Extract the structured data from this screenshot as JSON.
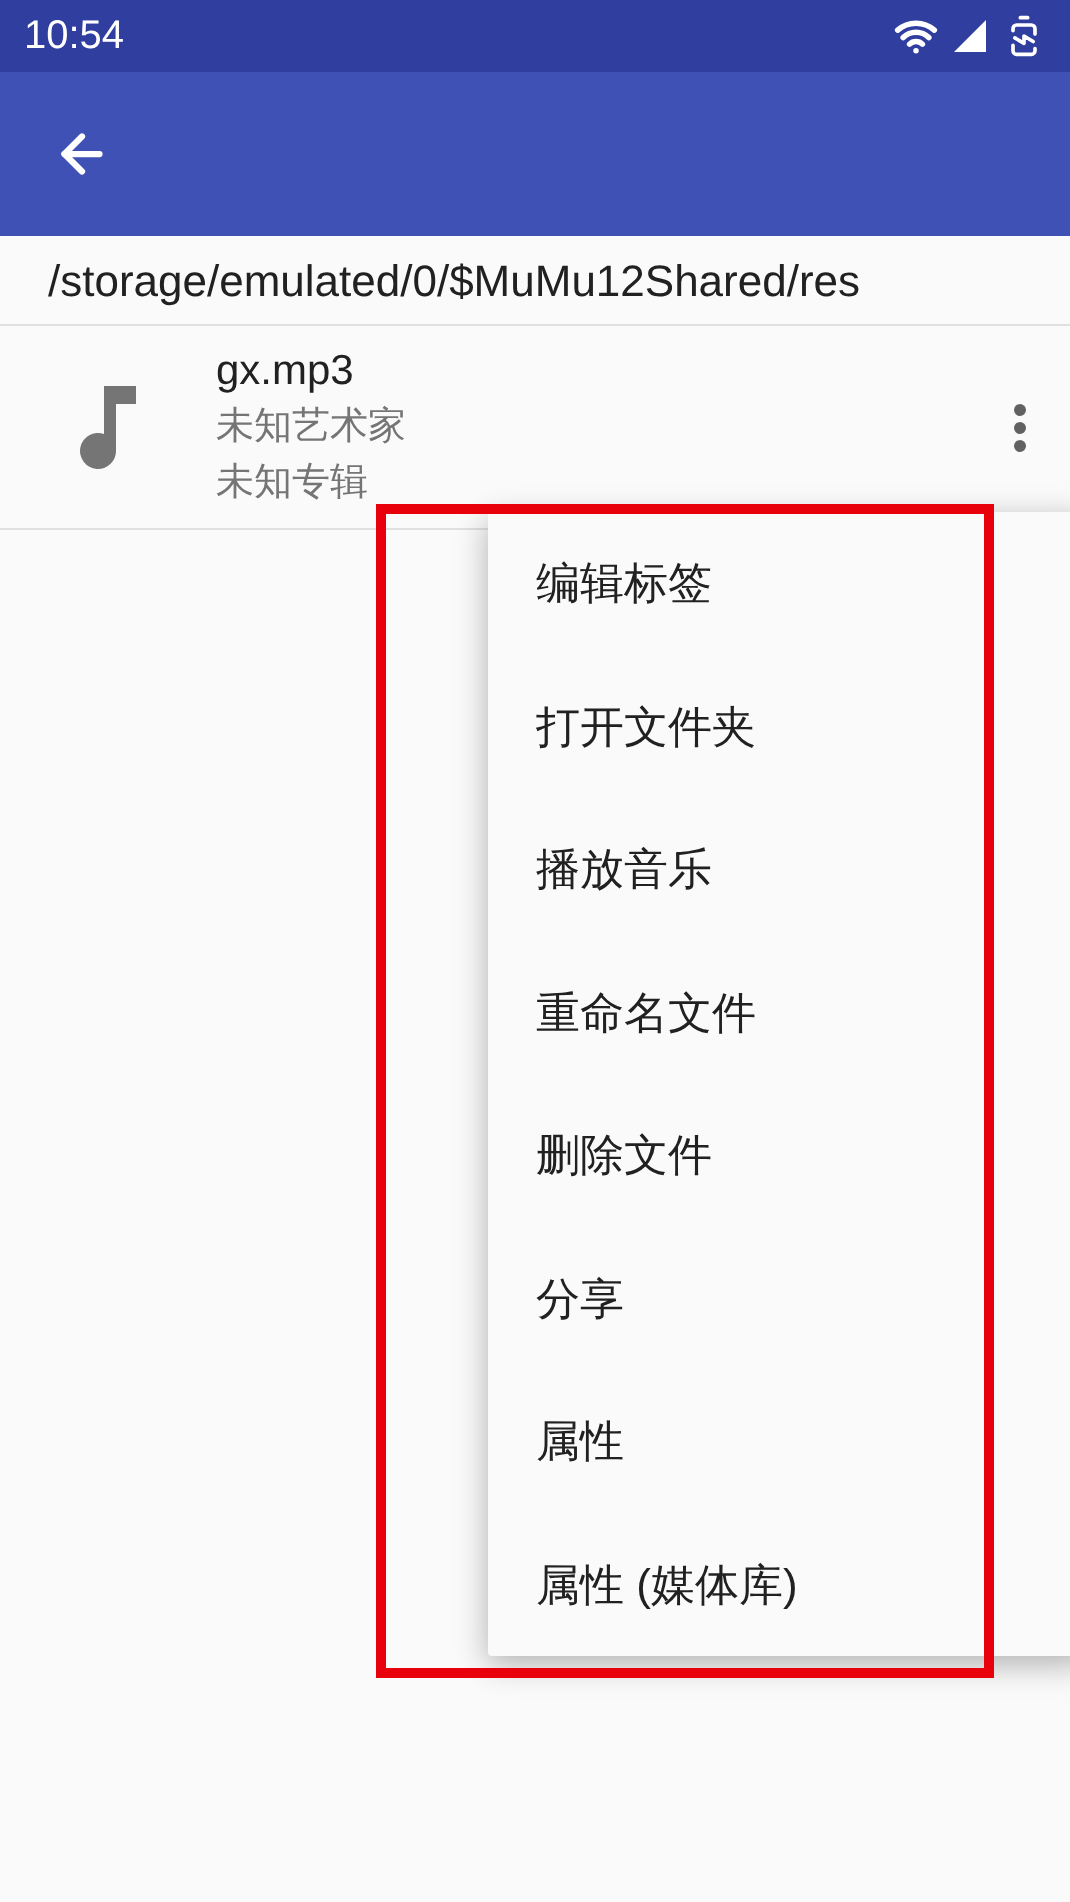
{
  "status_bar": {
    "time": "10:54"
  },
  "path": "/storage/emulated/0/$MuMu12Shared/res",
  "files": [
    {
      "name": "gx.mp3",
      "artist": "未知艺术家",
      "album": "未知专辑"
    }
  ],
  "menu": {
    "items": [
      "编辑标签",
      "打开文件夹",
      "播放音乐",
      "重命名文件",
      "删除文件",
      "分享",
      "属性",
      "属性 (媒体库)"
    ]
  }
}
